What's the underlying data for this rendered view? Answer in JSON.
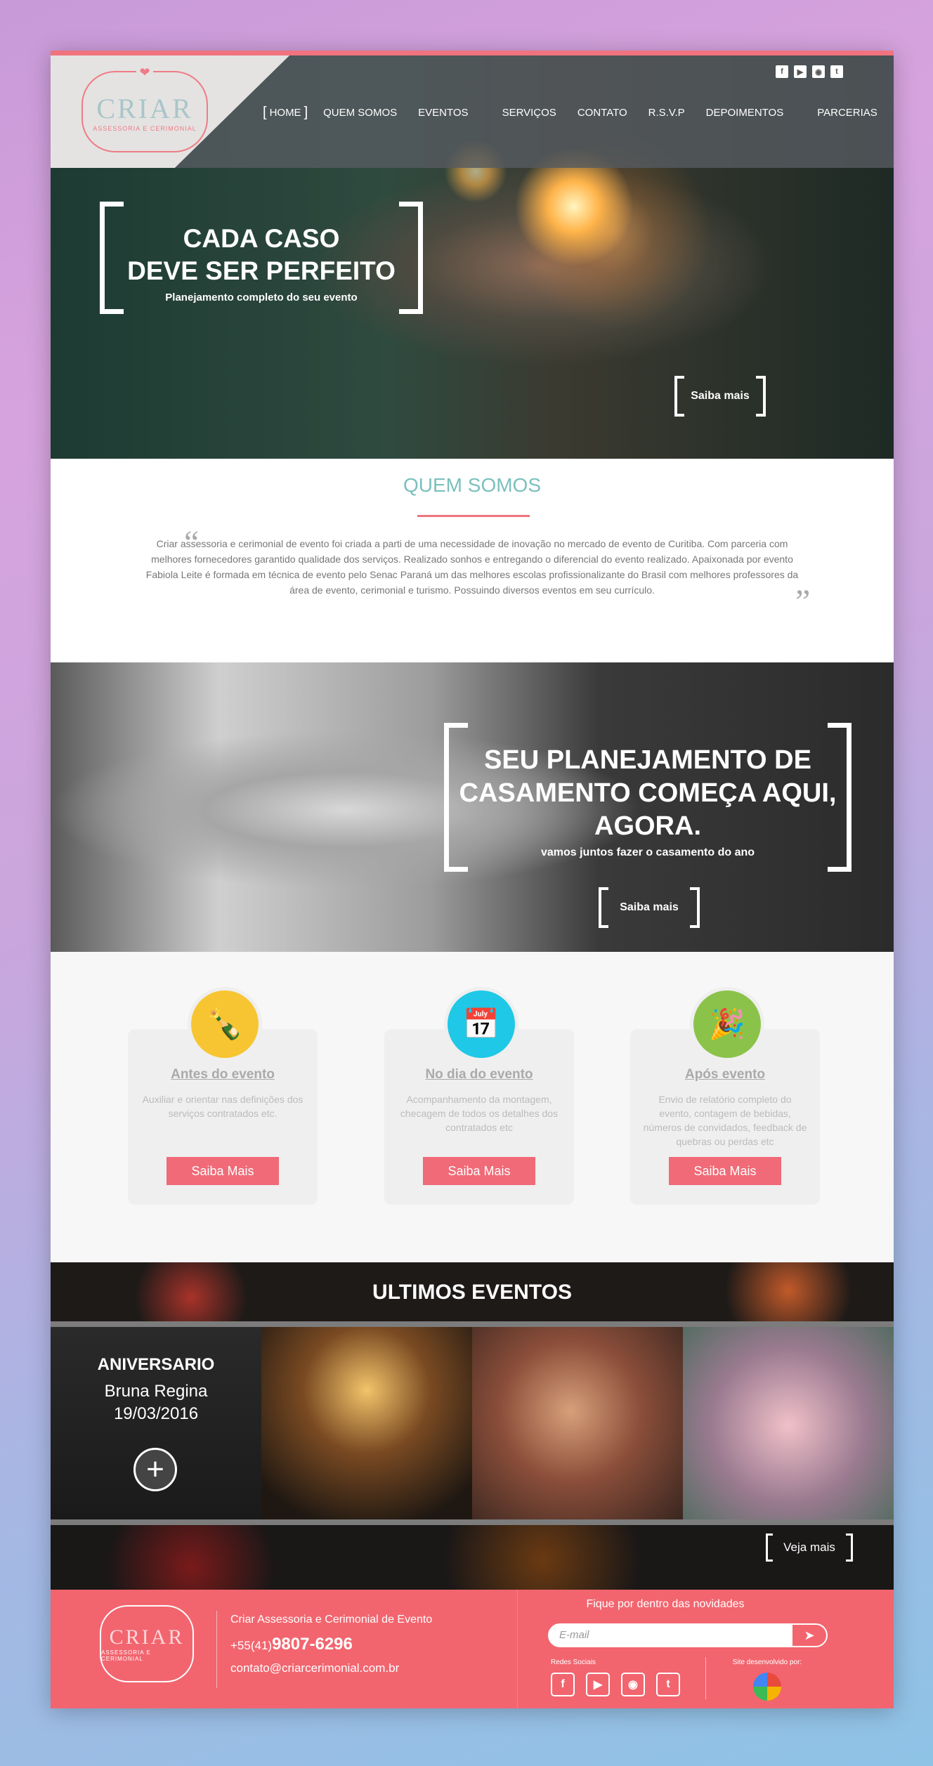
{
  "header": {
    "logo": {
      "word": "CRIAR",
      "sub": "ASSESSORIA E CERIMONIAL"
    },
    "social": [
      "facebook-icon",
      "youtube-icon",
      "instagram-icon",
      "twitter-icon"
    ],
    "nav": [
      "HOME",
      "QUEM SOMOS",
      "EVENTOS",
      "SERVIÇOS",
      "CONTATO",
      "R.S.V.P",
      "DEPOIMENTOS",
      "PARCERIAS"
    ]
  },
  "hero": {
    "title_line1": "CADA CASO",
    "title_line2": "DEVE SER PERFEITO",
    "subtitle": "Planejamento completo do seu evento",
    "button": "Saiba mais"
  },
  "quem_somos": {
    "title": "QUEM SOMOS",
    "text": "Criar assessoria e cerimonial de evento foi criada a parti de uma necessidade de inovação no mercado de evento de Curitiba. Com parceria com melhores fornecedores garantido qualidade dos serviços. Realizado sonhos e entregando o diferencial do evento realizado. Apaixonada por evento Fabiola Leite é formada em técnica de evento pelo Senac Paraná um das melhores escolas profissionalizante do Brasil com melhores professores da área de evento, cerimonial e turismo. Possuindo diversos eventos em seu currículo."
  },
  "casamento": {
    "title_line1": "SEU PLANEJAMENTO DE",
    "title_line2": "CASAMENTO COMEÇA AQUI,",
    "title_line3": "AGORA.",
    "subtitle": "vamos juntos fazer o casamento do ano",
    "button": "Saiba mais"
  },
  "services": [
    {
      "title": "Antes do evento",
      "text": "Auxiliar e orientar nas definições dos serviços contratados etc.",
      "button": "Saiba Mais",
      "icon": "bottle-icon",
      "color": "#f7c531"
    },
    {
      "title": "No dia do evento",
      "text": "Acompanhamento da montagem, checagem de todos os detalhes dos contratados etc",
      "button": "Saiba Mais",
      "icon": "calendar-icon",
      "color": "#1ec8e6"
    },
    {
      "title": "Após evento",
      "text": "Envio de relatório completo do evento, contagem de bebidas, números de convidados, feedback de quebras ou perdas etc",
      "button": "Saiba Mais",
      "icon": "champagne-icon",
      "color": "#8bc34a"
    }
  ],
  "eventos": {
    "title": "ULTIMOS EVENTOS",
    "featured": {
      "category": "ANIVERSARIO",
      "name": "Bruna Regina",
      "date": "19/03/2016"
    },
    "more": "Veja mais"
  },
  "footer": {
    "company": "Criar Assessoria e Cerimonial de Evento",
    "phone_prefix": "+55(41)",
    "phone": "9807-6296",
    "email": "contato@criarcerimonial.com.br",
    "newsletter_title": "Fique por dentro das novidades",
    "email_placeholder": "E-mail",
    "social_label": "Redes Sociais",
    "dev_label": "Site desenvolvido por:"
  },
  "colors": {
    "accent": "#f0737e",
    "teal": "#7bc0bd",
    "footer_bg": "#f2656f"
  }
}
